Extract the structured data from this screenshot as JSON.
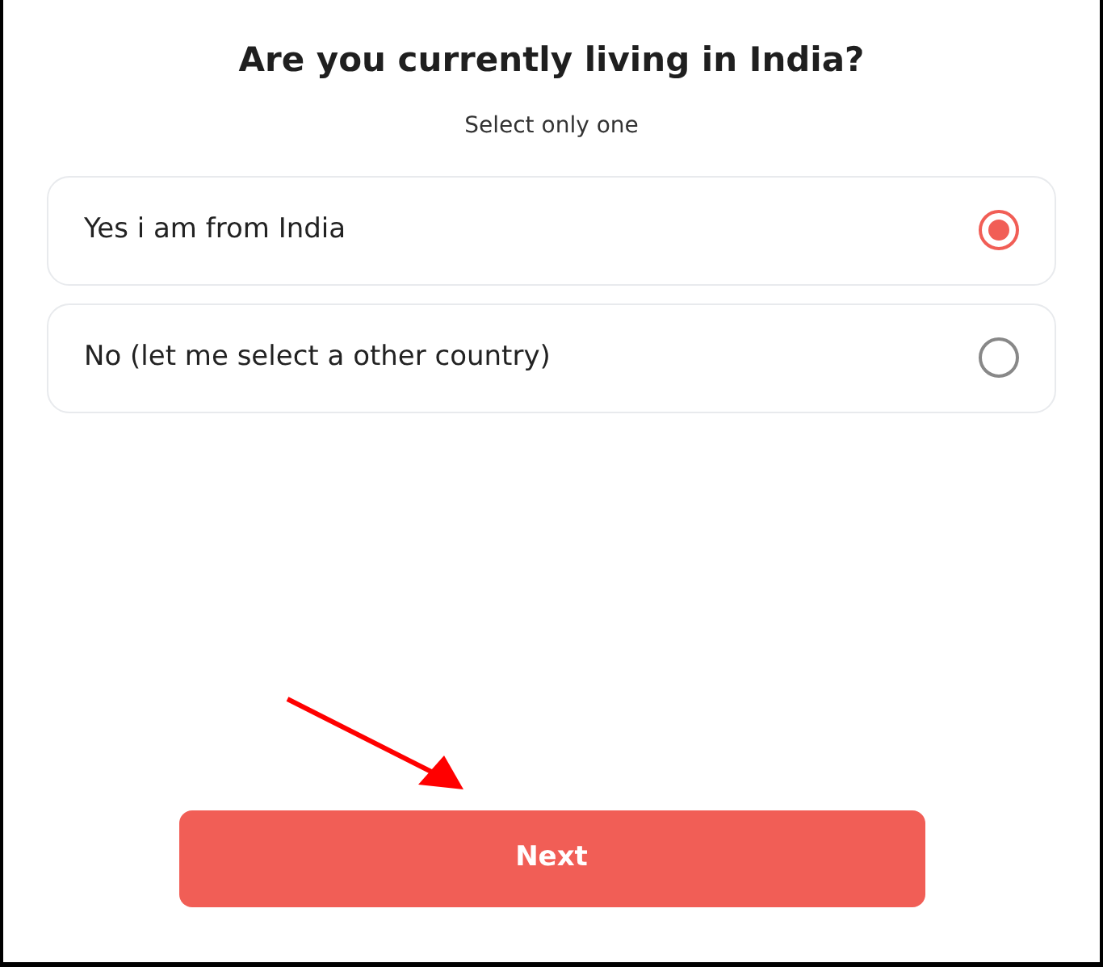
{
  "question": {
    "title": "Are you currently living in India?",
    "hint": "Select only one"
  },
  "options": [
    {
      "label": "Yes i am from India",
      "selected": true
    },
    {
      "label": "No (let me select a other country)",
      "selected": false
    }
  ],
  "button": {
    "label": "Next"
  }
}
